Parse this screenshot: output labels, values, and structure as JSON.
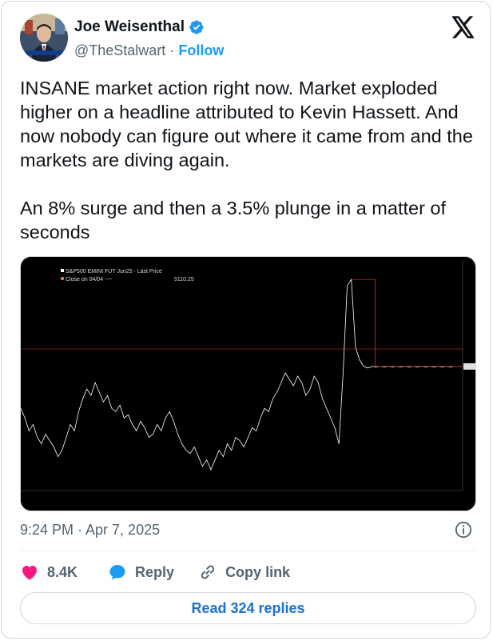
{
  "author": {
    "name": "Joe Weisenthal",
    "handle": "@TheStalwart",
    "separator": "·",
    "follow_label": "Follow"
  },
  "tweet": {
    "text": "INSANE market action right now. Market exploded higher on a headline attributed to Kevin Hassett. And now nobody can figure out where it came from and the markets are diving again.\n\nAn 8% surge and then a 3.5% plunge in a matter of seconds",
    "timestamp": "9:24 PM · Apr 7, 2025"
  },
  "actions": {
    "likes_count": "8.4K",
    "reply_label": "Reply",
    "copy_link_label": "Copy link",
    "read_replies_label": "Read 324 replies"
  },
  "colors": {
    "like": "#f91880",
    "reply": "#1d9bf0",
    "verified": "#1d9bf0",
    "replies_text": "#1d6fd0",
    "price_line": "#ffffff",
    "close_line": "#c23a2a"
  },
  "chart_data": {
    "type": "line",
    "legend": [
      {
        "label": "S&P500 EMINI FUT Jun25 - Last Price",
        "color": "#ffffff"
      },
      {
        "label": "Close on 04/04 ----",
        "value": "5110.25",
        "color": "#e06a3a"
      }
    ],
    "series": [
      {
        "values": [
          4950,
          4920,
          4880,
          4900,
          4860,
          4840,
          4870,
          4850,
          4830,
          4800,
          4820,
          4860,
          4900,
          4880,
          4940,
          4980,
          5010,
          4990,
          5030,
          5000,
          4970,
          4990,
          4950,
          4940,
          4960,
          4920,
          4930,
          4900,
          4880,
          4910,
          4890,
          4860,
          4870,
          4900,
          4880,
          4920,
          4940,
          4910,
          4870,
          4840,
          4820,
          4810,
          4830,
          4800,
          4770,
          4790,
          4760,
          4790,
          4820,
          4800,
          4840,
          4820,
          4860,
          4850,
          4830,
          4860,
          4890,
          4880,
          4920,
          4950,
          4940,
          4980,
          5000,
          5030,
          5060,
          5040,
          5020,
          5050,
          5030,
          4990,
          5010,
          5050,
          5030,
          4980,
          4950,
          4920,
          4890,
          4840,
          5060,
          5330,
          5350,
          5140,
          5100,
          5080,
          5075,
          5080,
          5078,
          5080,
          5078,
          5080,
          5078,
          5080,
          5078,
          5080,
          5078,
          5080,
          5078,
          5080,
          5078,
          5080,
          5078,
          5080,
          5078,
          5080,
          5078,
          5080
        ]
      }
    ],
    "ylim": [
      4700,
      5400
    ],
    "grid": false
  }
}
